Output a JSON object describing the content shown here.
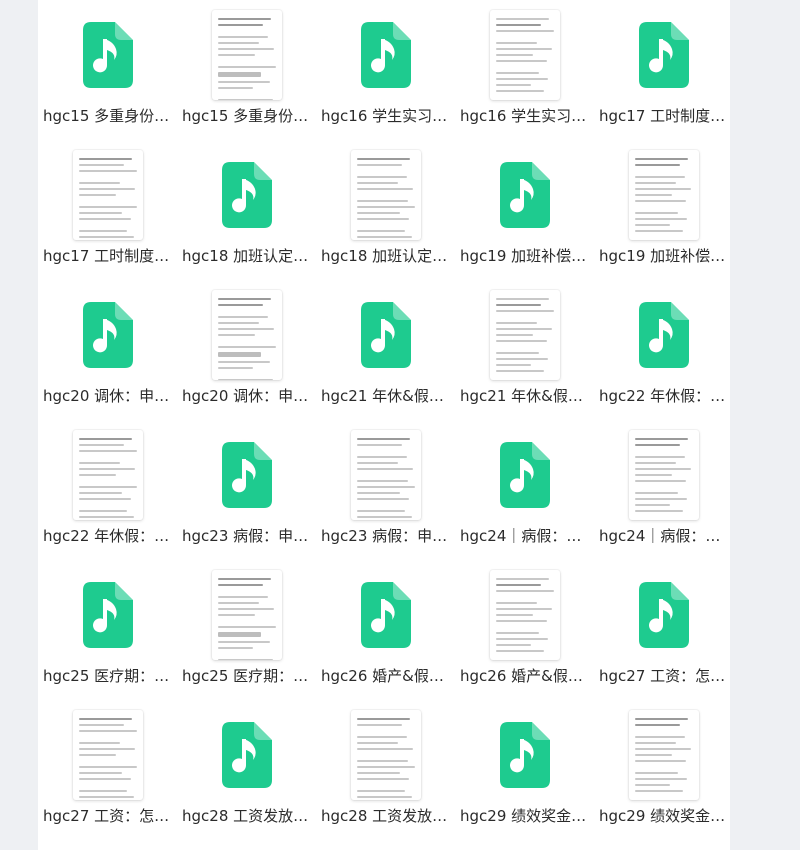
{
  "files": [
    {
      "name": "hgc15 多重身份…",
      "kind": "audio"
    },
    {
      "name": "hgc15 多重身份…",
      "kind": "doc"
    },
    {
      "name": "hgc16 学生实习…",
      "kind": "audio"
    },
    {
      "name": "hgc16 学生实习…",
      "kind": "doc"
    },
    {
      "name": "hgc17 工时制度…",
      "kind": "audio"
    },
    {
      "name": "hgc17 工时制度…",
      "kind": "doc"
    },
    {
      "name": "hgc18 加班认定…",
      "kind": "audio"
    },
    {
      "name": "hgc18 加班认定…",
      "kind": "doc"
    },
    {
      "name": "hgc19 加班补偿…",
      "kind": "audio"
    },
    {
      "name": "hgc19 加班补偿…",
      "kind": "doc"
    },
    {
      "name": "hgc20 调休：申…",
      "kind": "audio"
    },
    {
      "name": "hgc20 调休：申…",
      "kind": "doc"
    },
    {
      "name": "hgc21 年休&假…",
      "kind": "audio"
    },
    {
      "name": "hgc21 年休&假…",
      "kind": "doc"
    },
    {
      "name": "hgc22 年休假：…",
      "kind": "audio"
    },
    {
      "name": "hgc22 年休假：…",
      "kind": "doc"
    },
    {
      "name": "hgc23 病假：申…",
      "kind": "audio"
    },
    {
      "name": "hgc23 病假：申…",
      "kind": "doc"
    },
    {
      "name": "hgc24｜病假：…",
      "kind": "audio"
    },
    {
      "name": "hgc24｜病假：…",
      "kind": "doc"
    },
    {
      "name": "hgc25 医疗期：…",
      "kind": "audio"
    },
    {
      "name": "hgc25 医疗期：…",
      "kind": "doc"
    },
    {
      "name": "hgc26 婚产&假…",
      "kind": "audio"
    },
    {
      "name": "hgc26 婚产&假…",
      "kind": "doc"
    },
    {
      "name": "hgc27 工资：怎…",
      "kind": "audio"
    },
    {
      "name": "hgc27 工资：怎…",
      "kind": "doc"
    },
    {
      "name": "hgc28 工资发放…",
      "kind": "audio"
    },
    {
      "name": "hgc28 工资发放…",
      "kind": "doc"
    },
    {
      "name": "hgc29 绩效奖金…",
      "kind": "audio"
    },
    {
      "name": "hgc29 绩效奖金…",
      "kind": "doc"
    }
  ],
  "icons": {
    "audio": "music-file-icon",
    "doc": "document-thumbnail"
  },
  "colors": {
    "audio_icon": "#1ecb8f",
    "background": "#eef0f3",
    "panel": "#ffffff",
    "text": "#2b2b2b"
  }
}
